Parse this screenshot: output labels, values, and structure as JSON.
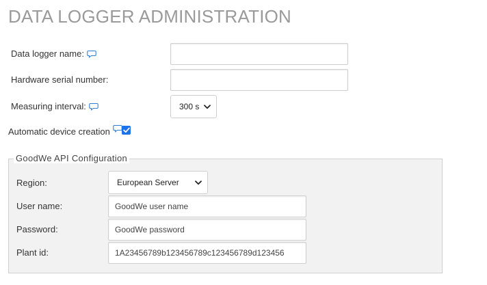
{
  "page": {
    "title": "DATA LOGGER ADMINISTRATION"
  },
  "form": {
    "logger_name_label": "Data logger name:",
    "logger_name_value": "",
    "serial_label": "Hardware serial number:",
    "serial_value": "",
    "interval_label": "Measuring interval:",
    "interval_value": "300 s",
    "auto_create_label": "Automatic device creation",
    "auto_create_checked": true
  },
  "goodwe": {
    "legend": "GoodWe API Configuration",
    "region_label": "Region:",
    "region_value": "European Server",
    "username_label": "User name:",
    "username_placeholder": "GoodWe user name",
    "password_label": "Password:",
    "password_placeholder": "GoodWe password",
    "plant_label": "Plant id:",
    "plant_placeholder": "1A23456789b123456789c123456789d123456"
  },
  "icons": {
    "comment": "comment-icon",
    "chevron": "chevron-down-icon",
    "check": "check-icon",
    "accent_color": "#1a73e8"
  }
}
